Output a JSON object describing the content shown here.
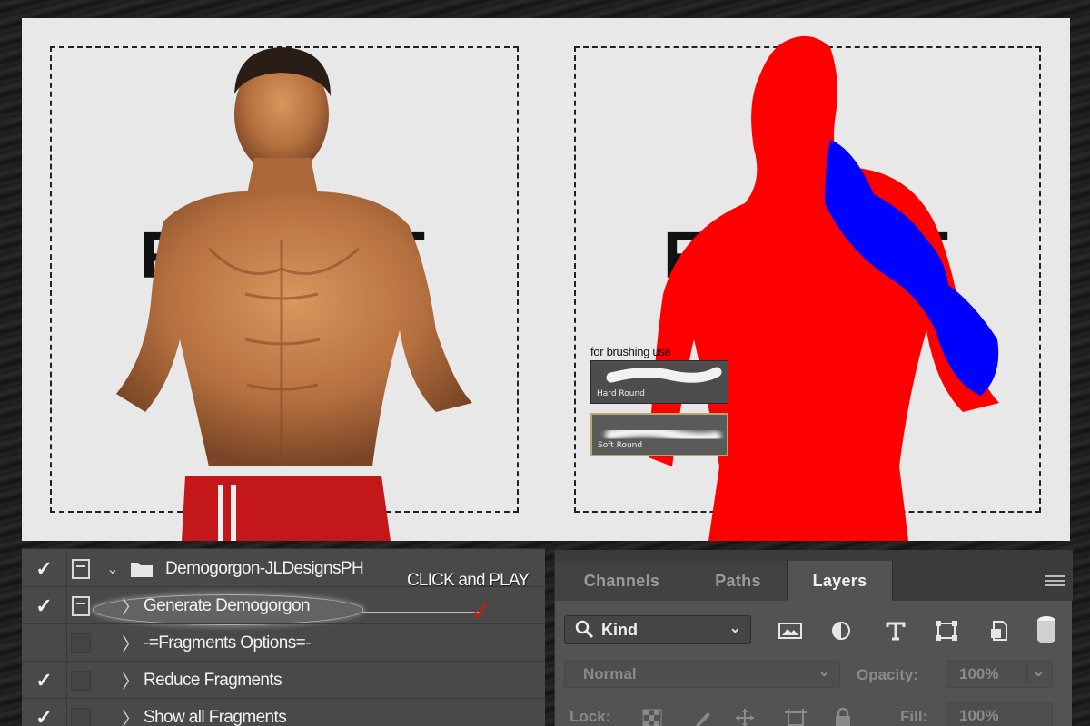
{
  "canvas": {
    "background_color": "#e8e8e8",
    "left_letters": [
      "F",
      "T"
    ],
    "right_letters": [
      "F",
      "T"
    ],
    "mask_colors": {
      "primary": "#ff0000",
      "secondary": "#0000ff"
    }
  },
  "brush_presets": {
    "caption": "for brushing use",
    "items": [
      {
        "label": "Hard Round",
        "selected": false
      },
      {
        "label": "Soft Round",
        "selected": true
      }
    ]
  },
  "actions_panel": {
    "rows": [
      {
        "checked": true,
        "dialog": true,
        "expand": "open",
        "folder": true,
        "label": "Demogorgon-JLDesignsPH"
      },
      {
        "checked": true,
        "dialog": true,
        "expand": "closed",
        "folder": false,
        "label": "Generate Demogorgon"
      },
      {
        "checked": false,
        "dialog": false,
        "expand": "closed",
        "folder": false,
        "label": "-=Fragments Options=-"
      },
      {
        "checked": true,
        "dialog": false,
        "expand": "closed",
        "folder": false,
        "label": "Reduce Fragments"
      },
      {
        "checked": true,
        "dialog": false,
        "expand": "closed",
        "folder": false,
        "label": "Show all Fragments"
      }
    ],
    "callout_text": "CLICK  and PLAY",
    "check_glyph": "✓",
    "expand_glyph": "〉",
    "open_glyph": "⌄",
    "callout_check_color": "#dd1111"
  },
  "layers_panel": {
    "tabs": [
      {
        "label": "Channels",
        "active": false
      },
      {
        "label": "Paths",
        "active": false
      },
      {
        "label": "Layers",
        "active": true
      }
    ],
    "filter": {
      "label": "Kind",
      "icons": [
        "image-filter-icon",
        "adjustment-filter-icon",
        "type-filter-icon",
        "shape-filter-icon",
        "smart-object-filter-icon",
        "toggle-filter-icon"
      ]
    },
    "blend_mode": "Normal",
    "opacity_label": "Opacity:",
    "opacity_value": "100%",
    "lock_label": "Lock:",
    "fill_label": "Fill:",
    "fill_value": "100%"
  }
}
